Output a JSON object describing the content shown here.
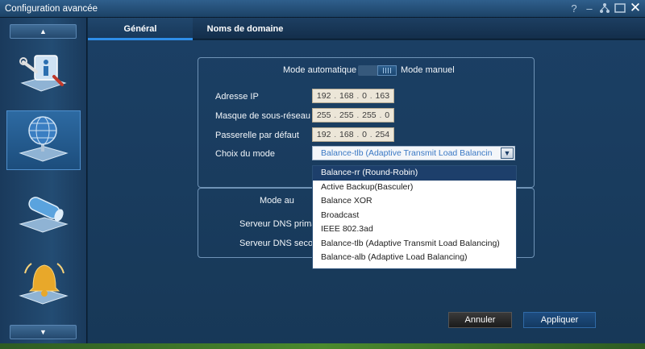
{
  "window": {
    "title": "Configuration avancée"
  },
  "title_icons": [
    "help-icon",
    "minimize-icon",
    "network-icon",
    "restore-icon",
    "close-icon"
  ],
  "sidebar": {
    "scroll_up_icon": "▲",
    "scroll_down_icon": "▼",
    "items": [
      {
        "icon": "settings-info-icon"
      },
      {
        "icon": "network-globe-icon",
        "active": true
      },
      {
        "icon": "cable-icon"
      },
      {
        "icon": "bell-icon"
      }
    ]
  },
  "tabs": [
    {
      "label": "Général",
      "active": true
    },
    {
      "label": "Noms de domaine"
    }
  ],
  "mode": {
    "left_label": "Mode automatique",
    "right_label": "Mode manuel"
  },
  "fields": {
    "ip_label": "Adresse IP",
    "ip": [
      "192",
      "168",
      "0",
      "163"
    ],
    "mask_label": "Masque de sous-réseau",
    "mask": [
      "255",
      "255",
      "255",
      "0"
    ],
    "gateway_label": "Passerelle par défaut",
    "gateway": [
      "192",
      "168",
      "0",
      "254"
    ],
    "mode_label": "Choix du mode",
    "mode_value": "Balance-tlb (Adaptive Transmit Load Balancin"
  },
  "dropdown": {
    "options": [
      "Balance-rr (Round-Robin)",
      "Active Backup(Basculer)",
      "Balance XOR",
      "Broadcast",
      "IEEE 802.3ad",
      "Balance-tlb (Adaptive Transmit Load Balancing)",
      "Balance-alb (Adaptive Load Balancing)"
    ],
    "selected_index": 0
  },
  "dns": {
    "mode_label": "Mode au",
    "primary_label": "Serveur DNS prima",
    "secondary_label": "Serveur DNS secor"
  },
  "buttons": {
    "cancel": "Annuler",
    "apply": "Appliquer"
  },
  "colors": {
    "accent": "#2f8ee8",
    "selected_option": "#1d3f6b",
    "select_text": "#3a78c4"
  }
}
